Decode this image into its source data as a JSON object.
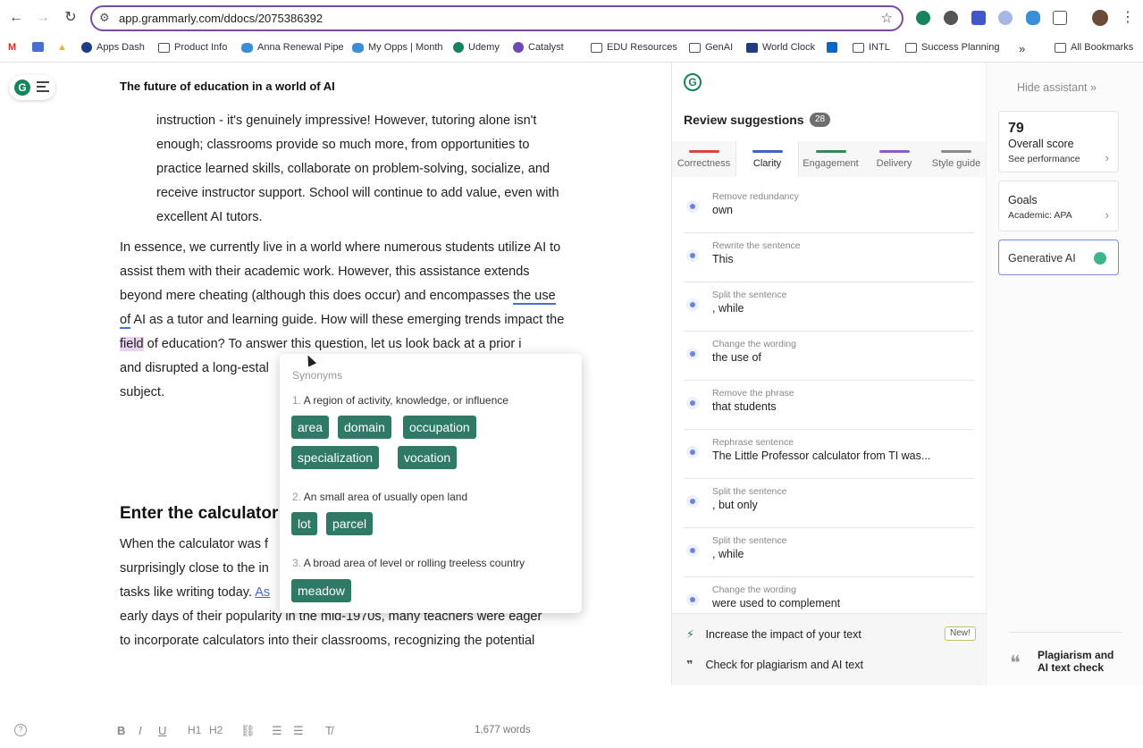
{
  "browser": {
    "url": "app.grammarly.com/ddocs/2075386392",
    "bookmarks": [
      "Apps Dash",
      "Product Info",
      "Anna Renewal Pipe",
      "My Opps | Month",
      "Udemy",
      "Catalyst",
      "EDU Resources",
      "GenAI",
      "World Clock",
      "INTL",
      "Success Planning",
      "All Bookmarks"
    ],
    "more": "»"
  },
  "doc": {
    "title": "The future of education in a world of AI",
    "quote": "instruction - it's genuinely impressive! However, tutoring alone isn't enough; classrooms provide so much more, from opportunities to practice learned skills, collaborate on problem-solving, socialize, and receive instructor support. School will continue to add value, even with excellent AI tutors.",
    "p1_a": "In essence, we currently live in a world where numerous students utilize AI to assist them with their academic work. However, this assistance extends beyond mere cheating (although this does occur) and encompasses ",
    "p1_ul": "the use of",
    "p1_b": " AI as a tutor and learning guide. How will these emerging trends impact the ",
    "p1_hl": "field",
    "p1_c": " of education? To answer this question, let us look back at a prior i",
    "p1_d": "and disrupted a long-estal",
    "p1_e": "subject.",
    "heading2": "Enter the calculator",
    "p2_a": "When the calculator was f",
    "p2_b": "surprisingly close to the in",
    "p2_c": "tasks like writing today. ",
    "p2_link": "As",
    "p2_d": "early days of their popularity in the mid-1970s, many teachers were eager",
    "p2_e": "to incorporate calculators into their classrooms, recognizing the potential",
    "word_count": "1,677 words"
  },
  "synonyms": {
    "header": "Synonyms",
    "senses": [
      {
        "num": "1.",
        "def": "A region of activity, knowledge, or influence",
        "words": [
          "area",
          "domain",
          "occupation",
          "specialization",
          "vocation"
        ]
      },
      {
        "num": "2.",
        "def": "An small area of usually open land",
        "words": [
          "lot",
          "parcel"
        ]
      },
      {
        "num": "3.",
        "def": "A broad area of level or rolling treeless country",
        "words": [
          "meadow"
        ]
      }
    ]
  },
  "assistant": {
    "title": "Review suggestions",
    "count": "28",
    "tabs": [
      {
        "label": "Correctness",
        "color": "#d9453a"
      },
      {
        "label": "Clarity",
        "color": "#3f62c8"
      },
      {
        "label": "Engagement",
        "color": "#2e8b57"
      },
      {
        "label": "Delivery",
        "color": "#8a5bd0"
      },
      {
        "label": "Style guide",
        "color": "#8a8a8a"
      }
    ],
    "suggestions": [
      {
        "type": "Remove redundancy",
        "text": "own"
      },
      {
        "type": "Rewrite the sentence",
        "text": "This"
      },
      {
        "type": "Split the sentence",
        "text": ", while"
      },
      {
        "type": "Change the wording",
        "text": "the use of"
      },
      {
        "type": "Remove the phrase",
        "text": "that students"
      },
      {
        "type": "Rephrase sentence",
        "text": "The Little Professor calculator from TI was..."
      },
      {
        "type": "Split the sentence",
        "text": ", but only"
      },
      {
        "type": "Split the sentence",
        "text": ", while"
      },
      {
        "type": "Change the wording",
        "text": "were used to complement"
      }
    ],
    "impact": "Increase the impact of your text",
    "new_badge": "New!",
    "plagiarism_check": "Check for plagiarism and AI text"
  },
  "sidebar": {
    "hide": "Hide assistant",
    "score": "79",
    "score_label": "Overall score",
    "score_link": "See performance",
    "goals_label": "Goals",
    "goals_value": "Academic: APA",
    "genai": "Generative AI",
    "plagiarism": "Plagiarism and AI text check"
  }
}
